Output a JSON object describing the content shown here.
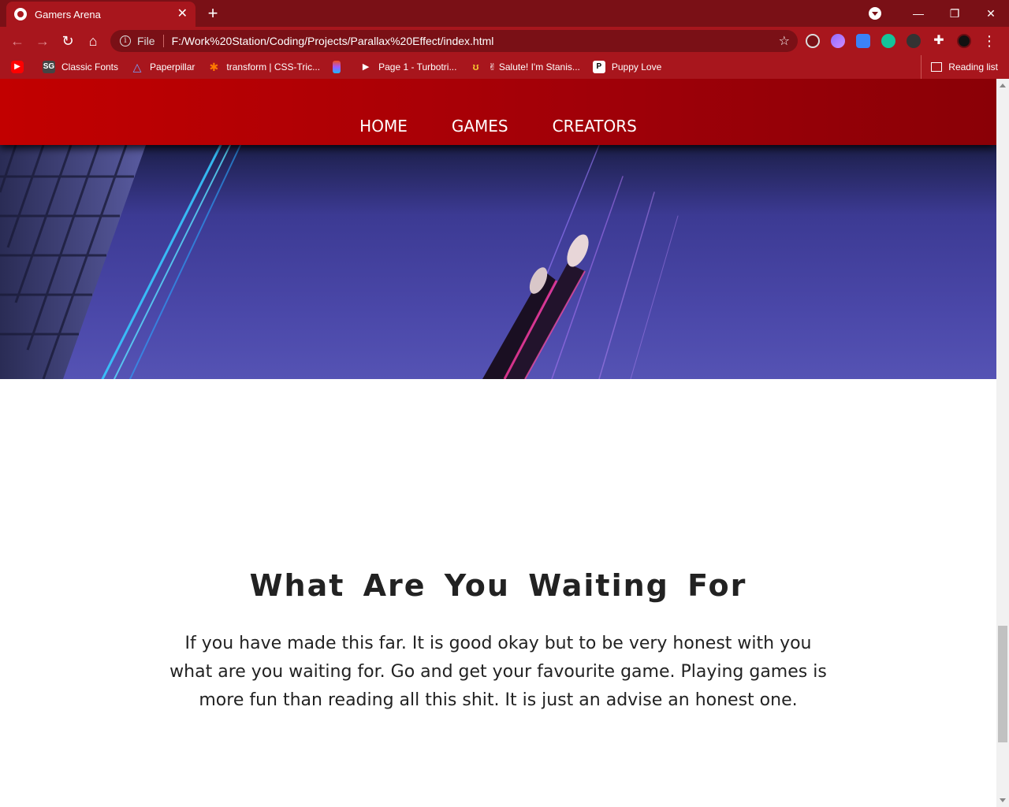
{
  "browser": {
    "tab": {
      "title": "Gamers Arena",
      "close": "✕"
    },
    "new_tab": "+",
    "window_controls": {
      "minimize": "—",
      "restore": "❐",
      "close": "✕"
    },
    "toolbar": {
      "back": "←",
      "forward": "→",
      "reload": "↻",
      "home": "⌂",
      "scheme": "File",
      "url": "F:/Work%20Station/Coding/Projects/Parallax%20Effect/index.html",
      "star": "☆",
      "extensions_icon": "✚",
      "menu_icon": "⋮"
    },
    "bookmarks": [
      {
        "icon": "youtube-icon",
        "label": ""
      },
      {
        "icon": "classic-fonts-icon",
        "label": "Classic Fonts"
      },
      {
        "icon": "paperpillar-icon",
        "label": "Paperpillar"
      },
      {
        "icon": "css-tricks-icon",
        "label": "transform | CSS-Tric..."
      },
      {
        "icon": "figma-icon",
        "label": ""
      },
      {
        "icon": "play-icon",
        "label": "Page 1 - Turbotri..."
      },
      {
        "icon": "hand-icon",
        "label": "✌ Salute! I'm Stanis..."
      },
      {
        "icon": "puppy-love-icon",
        "label": "Puppy Love"
      }
    ],
    "reading_list": "Reading list"
  },
  "site": {
    "nav": [
      "HOME",
      "GAMES",
      "CREATORS"
    ],
    "heading": "What Are You Waiting For",
    "paragraph": "If you have made this far. It is good okay but to be very honest with you what are you waiting for. Go and get your favourite game. Playing games is more fun than reading all this shit. It is just an advise an honest one."
  },
  "colors": {
    "browser_frame": "#7a1016",
    "toolbar": "#a8161d",
    "nav_red": "#c20000",
    "hero_blue": "#4a47a8"
  }
}
